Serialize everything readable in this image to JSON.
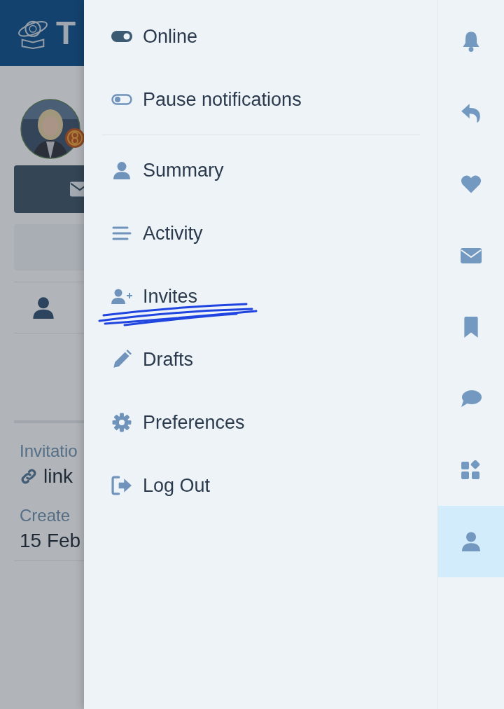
{
  "background": {
    "logo_text": "T",
    "invitation_label": "Invitatio",
    "invitation_value": "link",
    "created_label": "Create",
    "created_value": "15 Feb"
  },
  "status_menu": [
    {
      "label": "Online",
      "on": true
    },
    {
      "label": "Pause notifications",
      "on": false
    }
  ],
  "menu_items": [
    {
      "label": "Summary"
    },
    {
      "label": "Activity"
    },
    {
      "label": "Invites"
    },
    {
      "label": "Drafts"
    },
    {
      "label": "Preferences"
    },
    {
      "label": "Log Out"
    }
  ],
  "rail_tabs": [
    {
      "selected": false
    },
    {
      "selected": false
    },
    {
      "selected": false
    },
    {
      "selected": false
    },
    {
      "selected": false
    },
    {
      "selected": false
    },
    {
      "selected": false
    },
    {
      "selected": true
    }
  ]
}
